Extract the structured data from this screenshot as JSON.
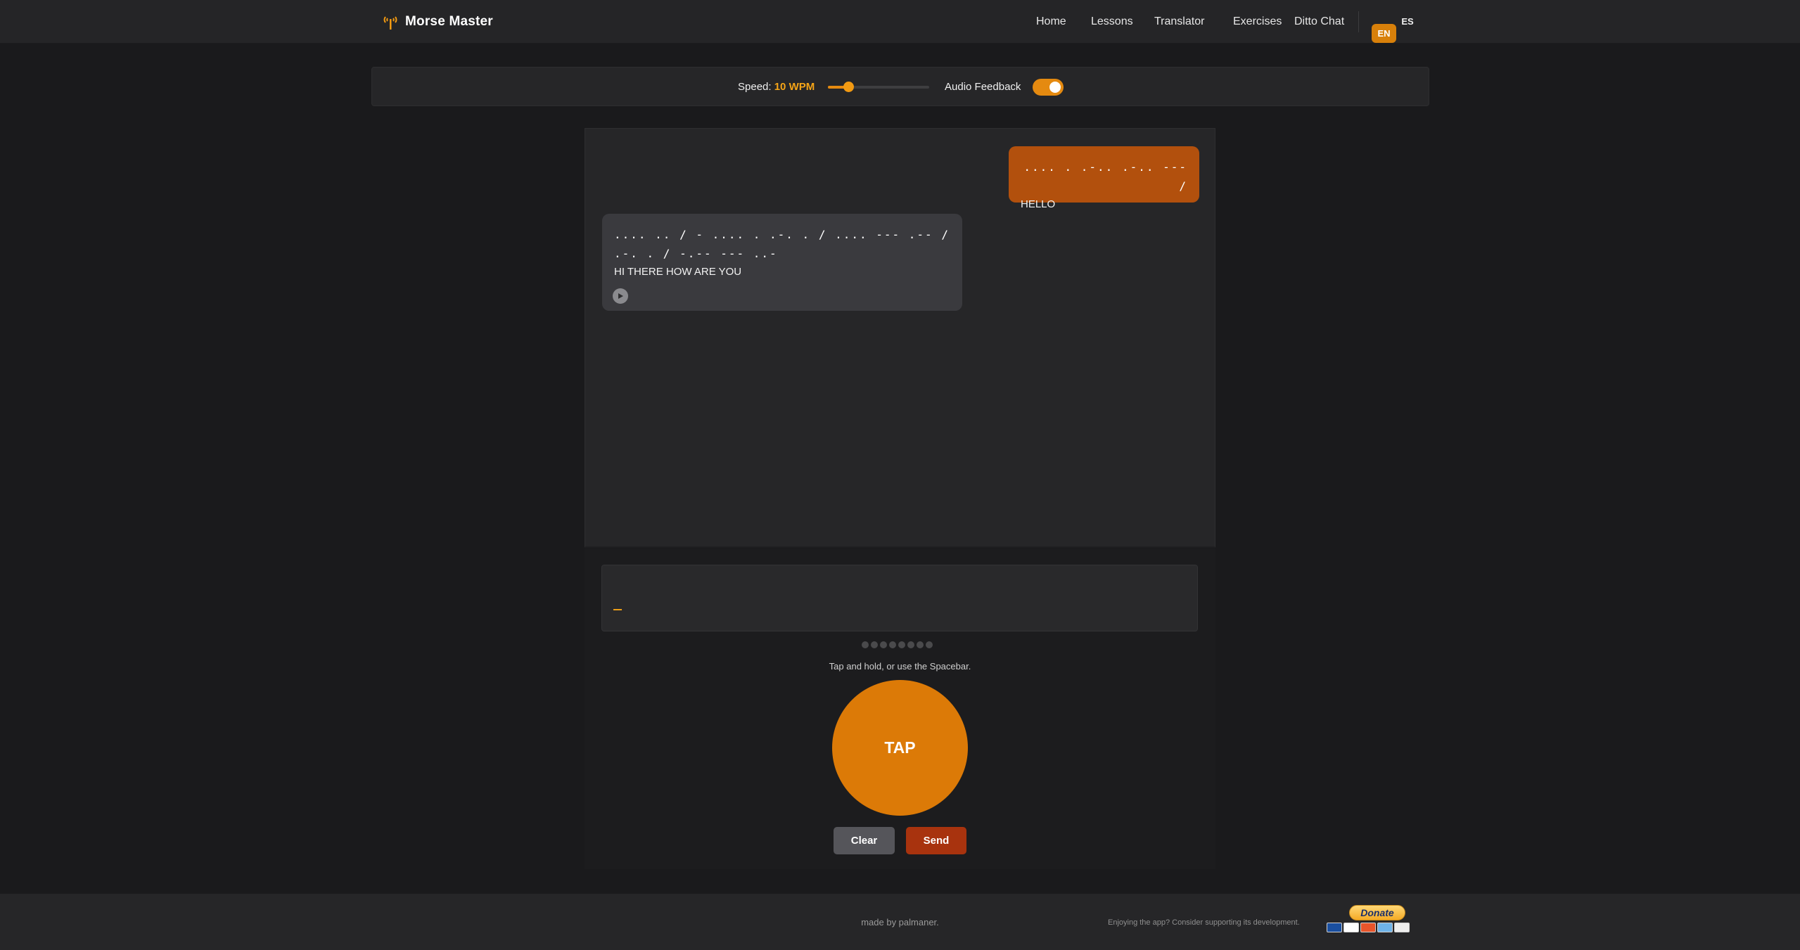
{
  "header": {
    "brand": "Morse Master",
    "brand_icon": "antenna-icon",
    "nav": [
      {
        "label": "Home",
        "name": "nav-home"
      },
      {
        "label": "Lessons",
        "name": "nav-lessons"
      },
      {
        "label": "Translator",
        "name": "nav-translator"
      },
      {
        "label": "Exercises",
        "name": "nav-exercises"
      },
      {
        "label": "Ditto Chat",
        "name": "nav-ditto-chat"
      }
    ],
    "languages": {
      "active": "EN",
      "other": "ES"
    }
  },
  "controls": {
    "speed_label": "Speed:",
    "speed_value": "10 WPM",
    "speed_wpm": 10,
    "speed_fraction": 0.2,
    "audio_label": "Audio Feedback",
    "audio_enabled": true
  },
  "chat": {
    "messages": [
      {
        "direction": "out",
        "morse": ".... . .-.. .-.. --- /",
        "text": "HELLO"
      },
      {
        "direction": "in",
        "morse": ".... .. / - .... . .-. . / .... --- .-- / .-. . / -.-- --- ..-",
        "text": "HI THERE HOW ARE YOU",
        "play_icon": "play-icon"
      }
    ]
  },
  "input": {
    "cursor": "_",
    "dots_count": 8,
    "hint": "Tap and hold, or use the Spacebar.",
    "tap_label": "TAP",
    "clear_label": "Clear",
    "send_label": "Send"
  },
  "footer": {
    "made_by": "made by palmaner.",
    "support_text": "Enjoying the app? Consider supporting its development.",
    "donate_label": "Donate"
  },
  "colors": {
    "accent": "#e58a10",
    "out_bubble": "#b2500d",
    "in_bubble": "#3a3a3e",
    "send": "#a8330e",
    "background": "#1a1a1c"
  }
}
